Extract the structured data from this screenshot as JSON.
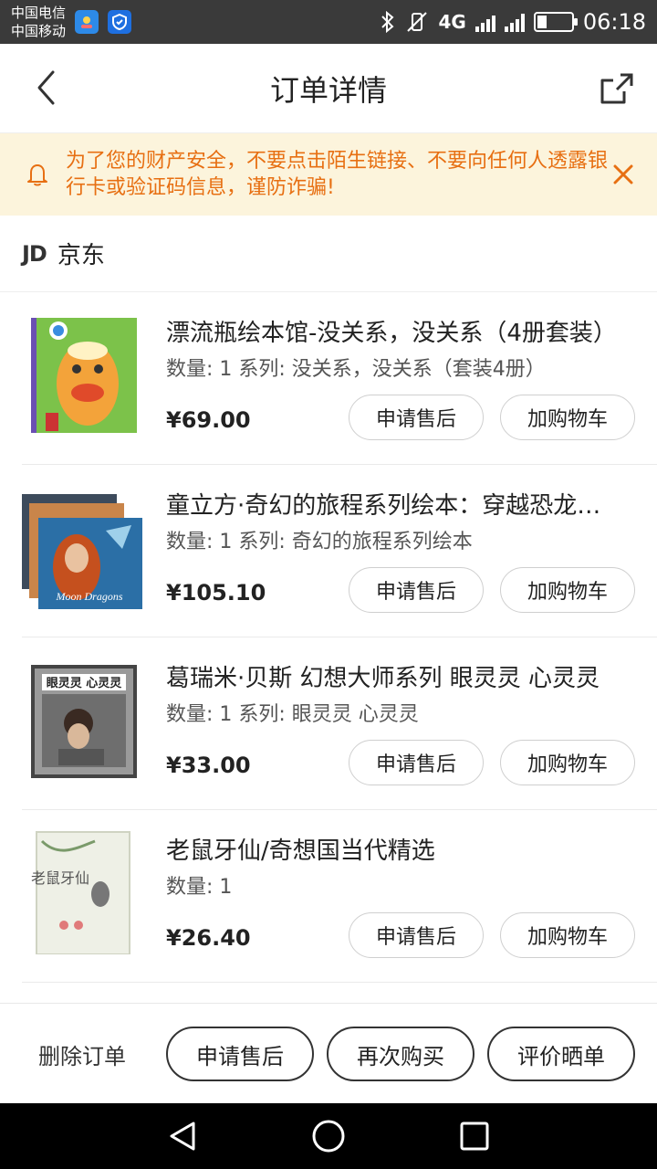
{
  "status_bar": {
    "carrier1": "中国电信",
    "carrier2": "中国移动",
    "network": "4G",
    "time": "06:18"
  },
  "header": {
    "title": "订单详情"
  },
  "warning": {
    "text": "为了您的财产安全，不要点击陌生链接、不要向任何人透露银行卡或验证码信息，谨防诈骗!"
  },
  "shop": {
    "logo": "JD",
    "name": "京东"
  },
  "items": [
    {
      "title": "漂流瓶绘本馆-没关系，没关系（4册套装）",
      "spec": "数量: 1 系列: 没关系，没关系（套装4册）",
      "price": "¥69.00",
      "after_sale_label": "申请售后",
      "cart_label": "加购物车"
    },
    {
      "title": "童立方·奇幻的旅程系列绘本：穿越恐龙时代",
      "spec": "数量: 1 系列: 奇幻的旅程系列绘本",
      "price": "¥105.10",
      "after_sale_label": "申请售后",
      "cart_label": "加购物车",
      "cover_text": "Moon Dragons"
    },
    {
      "title": "葛瑞米·贝斯 幻想大师系列 眼灵灵 心灵灵",
      "spec": "数量: 1 系列: 眼灵灵 心灵灵",
      "price": "¥33.00",
      "after_sale_label": "申请售后",
      "cart_label": "加购物车",
      "cover_text": "眼灵灵 心灵灵"
    },
    {
      "title": "老鼠牙仙/奇想国当代精选",
      "spec": "数量: 1",
      "price": "¥26.40",
      "after_sale_label": "申请售后",
      "cart_label": "加购物车",
      "cover_text": "老鼠牙仙"
    }
  ],
  "bottom_bar": {
    "delete_label": "删除订单",
    "after_sale_label": "申请售后",
    "rebuy_label": "再次购买",
    "review_label": "评价晒单"
  },
  "colors": {
    "warning_bg": "#fcf4dc",
    "warning_text": "#e76f12",
    "status_bar_bg": "#3a3a3a"
  }
}
